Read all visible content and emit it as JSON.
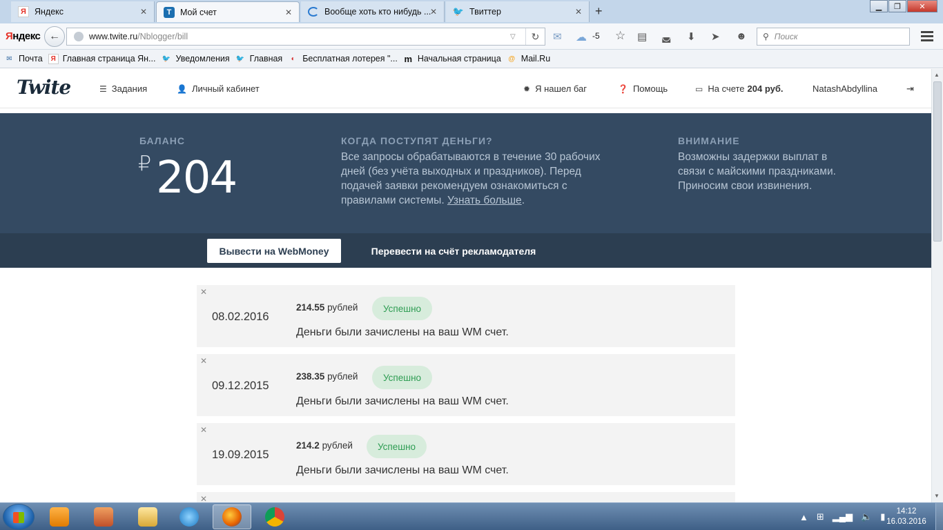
{
  "browser": {
    "tabs": [
      {
        "title": "Яндекс",
        "icon": "yandex-icon"
      },
      {
        "title": "Мой счет",
        "icon": "twite-icon",
        "active": true
      },
      {
        "title": "Вообще хоть кто нибудь ...",
        "icon": "loading-icon"
      },
      {
        "title": "Твиттер",
        "icon": "twitter-icon"
      }
    ],
    "yandex_logo_black": "Я",
    "yandex_logo_red": "ндекс",
    "url_host": "www.twite.ru",
    "url_path": "/Nblogger/bill",
    "weather": "-5",
    "search_placeholder": "Поиск",
    "bookmarks": [
      {
        "label": "Почта",
        "icon": "mail-icon"
      },
      {
        "label": "Главная страница Ян...",
        "icon": "yandex-icon"
      },
      {
        "label": "Уведомления",
        "icon": "twitter-icon"
      },
      {
        "label": "Главная",
        "icon": "twitter-icon"
      },
      {
        "label": "Бесплатная лотерея \"...",
        "icon": "lottery-icon"
      },
      {
        "label": "Начальная страница",
        "icon": "m-icon"
      },
      {
        "label": "Mail.Ru",
        "icon": "mailru-icon"
      }
    ]
  },
  "site": {
    "logo": "Twite",
    "nav": {
      "tasks": "Задания",
      "cabinet": "Личный кабинет",
      "bug": "Я нашел баг",
      "help": "Помощь",
      "account_prefix": "На счете",
      "account_amount": "204 руб.",
      "username": "NatashAbdyllina"
    },
    "hero": {
      "balance_heading": "Баланс",
      "currency_symbol": "₽",
      "balance_value": "204",
      "when_heading": "Когда поступят деньги?",
      "when_text": "Все запросы обрабатываются в течение 30 рабочих дней (без учёта выходных и праздников). Перед подачей заявки рекомендуем ознакомиться с правилами системы. ",
      "when_link": "Узнать больше",
      "when_tail": ".",
      "attention_heading": "Внимание",
      "attention_text": "Возможны задержки выплат в связи с майскими праздниками. Приносим свои извинения."
    },
    "tabs": {
      "webmoney": "Вывести на WebMoney",
      "advertiser": "Перевести на счёт рекламодателя"
    },
    "payments": [
      {
        "date": "08.02.2016",
        "amount": "214.55",
        "unit": "рублей",
        "status": "Успешно",
        "message": "Деньги были зачислены на ваш WM счет."
      },
      {
        "date": "09.12.2015",
        "amount": "238.35",
        "unit": "рублей",
        "status": "Успешно",
        "message": "Деньги были зачислены на ваш WM счет."
      },
      {
        "date": "19.09.2015",
        "amount": "214.2",
        "unit": "рублей",
        "status": "Успешно",
        "message": "Деньги были зачислены на ваш WM счет."
      }
    ]
  },
  "taskbar": {
    "apps": [
      "media-player",
      "installer",
      "file-explorer",
      "internet-explorer",
      "firefox",
      "chrome"
    ],
    "time": "14:12",
    "date": "16.03.2016"
  },
  "colors": {
    "hero_bg": "#344a62",
    "tabs_bg": "#2c3e51",
    "success_bg": "#d7ecdc",
    "success_text": "#2d9c52"
  }
}
